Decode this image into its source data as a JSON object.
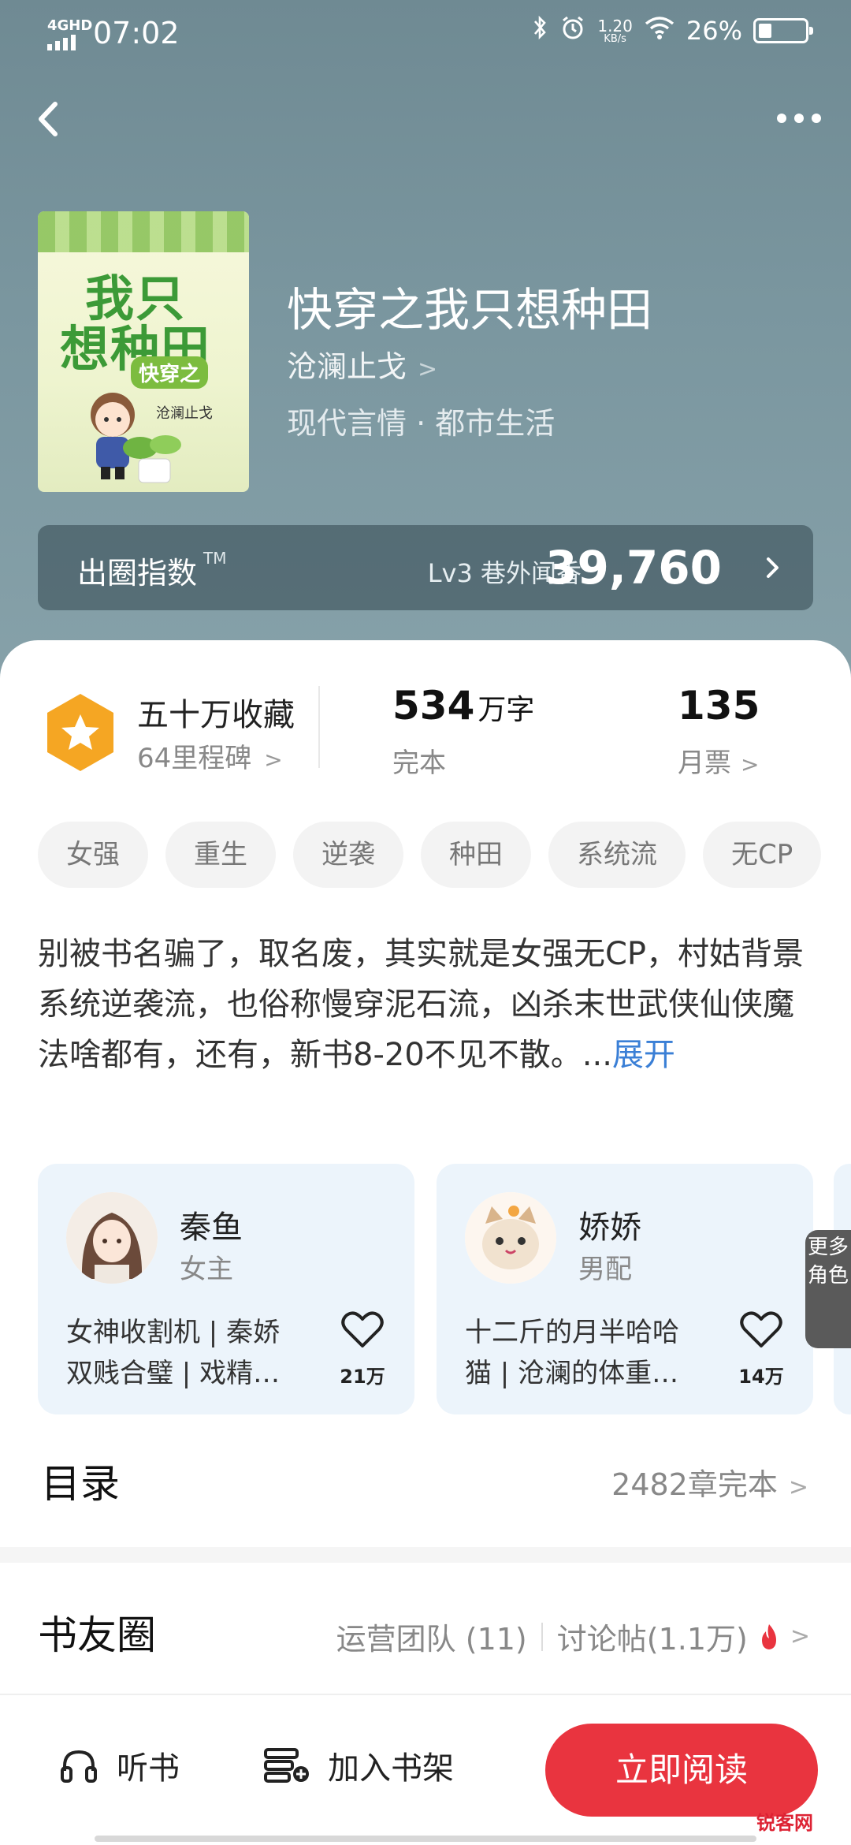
{
  "status_bar": {
    "network": "4GHD",
    "time": "07:02",
    "speed_value": "1.20",
    "speed_unit": "KB/s",
    "battery": "26%"
  },
  "nav": {
    "back_icon": "chevron-left-icon",
    "more_icon": "more-dots-icon"
  },
  "book": {
    "cover_title_line1": "我只",
    "cover_title_line2": "想种田",
    "cover_tag": "快穿之",
    "cover_author": "沧澜止戈",
    "title": "快穿之我只想种田",
    "author": "沧澜止戈",
    "genre": "现代言情 · 都市生活"
  },
  "influence": {
    "label": "出圈指数",
    "tm": "TM",
    "level": "Lv3 巷外闻香",
    "score": "39,760"
  },
  "stats": {
    "collect_title": "五十万收藏",
    "collect_sub": "64里程碑",
    "words_value": "534",
    "words_unit": "万字",
    "words_sub": "完本",
    "tickets_value": "135",
    "tickets_sub": "月票"
  },
  "tags": [
    "女强",
    "重生",
    "逆袭",
    "种田",
    "系统流",
    "无CP"
  ],
  "synopsis": {
    "text": "别被书名骗了，取名废，其实就是女强无CP，村姑背景系统逆袭流，也俗称慢穿泥石流，凶杀末世武侠仙侠魔法啥都有，还有，新书8-20不见不散。...",
    "expand": "展开"
  },
  "characters": [
    {
      "name": "秦鱼",
      "role": "女主",
      "desc_line1": "女神收割机 | 秦娇",
      "desc_line2": "双贱合璧 | 戏精…",
      "likes": "21万"
    },
    {
      "name": "娇娇",
      "role": "男配",
      "desc_line1": "十二斤的月半哈哈",
      "desc_line2": "猫 | 沧澜的体重…",
      "likes": "14万"
    }
  ],
  "more_roles": "更多角色",
  "toc": {
    "title": "目录",
    "count": "2482章完本"
  },
  "circle": {
    "title": "书友圈",
    "team": "运营团队 (11)",
    "posts": "讨论帖(1.1万)"
  },
  "bottom": {
    "listen": "听书",
    "add_shelf": "加入书架",
    "read": "立即阅读"
  },
  "watermark": "锐客网",
  "colors": {
    "accent_red": "#e9343f",
    "link_blue": "#3a7fd6",
    "badge_orange": "#f5a623"
  }
}
